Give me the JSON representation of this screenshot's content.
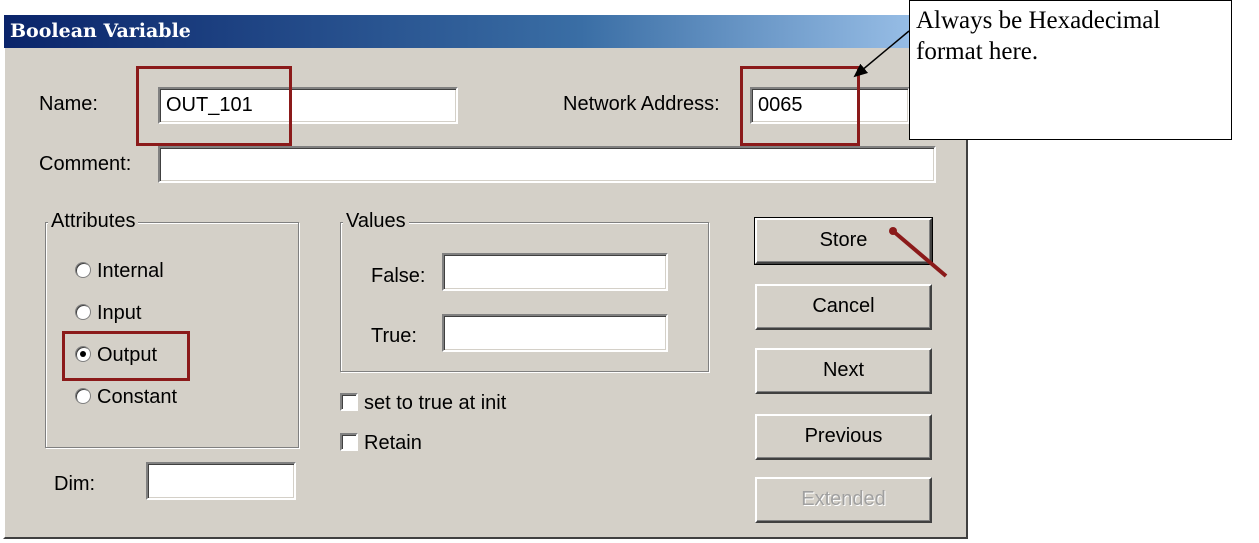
{
  "window": {
    "title": "Boolean Variable"
  },
  "fields": {
    "name_label": "Name:",
    "name_value": "OUT_101",
    "network_address_label": "Network Address:",
    "network_address_value": "0065",
    "comment_label": "Comment:",
    "comment_value": "",
    "dim_label": "Dim:",
    "dim_value": ""
  },
  "attributes": {
    "legend": "Attributes",
    "options": [
      {
        "label": "Internal",
        "selected": false
      },
      {
        "label": "Input",
        "selected": false
      },
      {
        "label": "Output",
        "selected": true
      },
      {
        "label": "Constant",
        "selected": false
      }
    ]
  },
  "values": {
    "legend": "Values",
    "false_label": "False:",
    "false_value": "",
    "true_label": "True:",
    "true_value": ""
  },
  "checkboxes": {
    "set_true_init": {
      "label": "set to true at init",
      "checked": false
    },
    "retain": {
      "label": "Retain",
      "checked": false
    }
  },
  "buttons": {
    "store": "Store",
    "cancel": "Cancel",
    "next": "Next",
    "previous": "Previous",
    "extended": "Extended"
  },
  "annotation": {
    "text": "Always be Hexadecimal format here.",
    "highlight_color": "#8b1a1a"
  }
}
